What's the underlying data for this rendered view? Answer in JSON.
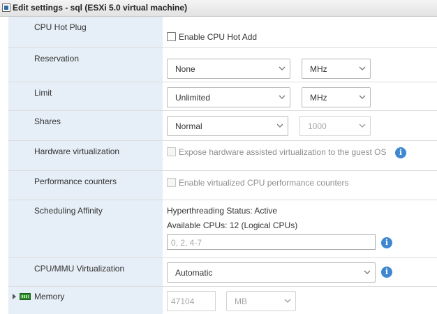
{
  "window": {
    "title": "Edit settings - sql (ESXi 5.0 virtual machine)"
  },
  "rows": {
    "cpu_hot_plug": {
      "label": "CPU Hot Plug",
      "checkbox_label": "Enable CPU Hot Add",
      "checked": false
    },
    "reservation": {
      "label": "Reservation",
      "value": "None",
      "unit": "MHz"
    },
    "limit": {
      "label": "Limit",
      "value": "Unlimited",
      "unit": "MHz"
    },
    "shares": {
      "label": "Shares",
      "value": "Normal",
      "amount": "1000"
    },
    "hardware_virtualization": {
      "label": "Hardware virtualization",
      "checkbox_label": "Expose hardware assisted virtualization to the guest OS",
      "checked": false,
      "enabled": false
    },
    "performance_counters": {
      "label": "Performance counters",
      "checkbox_label": "Enable virtualized CPU performance counters",
      "checked": false,
      "enabled": false
    },
    "scheduling_affinity": {
      "label": "Scheduling Affinity",
      "hyperthreading_status": "Hyperthreading Status: Active",
      "available_cpus": "Available CPUs: 12 (Logical CPUs)",
      "placeholder": "0, 2, 4-7"
    },
    "cpu_mmu": {
      "label": "CPU/MMU Virtualization",
      "value": "Automatic"
    },
    "memory": {
      "label": "Memory",
      "value": "47104",
      "unit": "MB"
    }
  },
  "icons": {
    "info": "info-icon",
    "dropdown": "chevron-down-icon",
    "expand": "expand-arrow-icon",
    "memory": "memory-icon"
  },
  "colors": {
    "label_bg": "#e6eff7",
    "info_blue": "#3f87d0"
  }
}
